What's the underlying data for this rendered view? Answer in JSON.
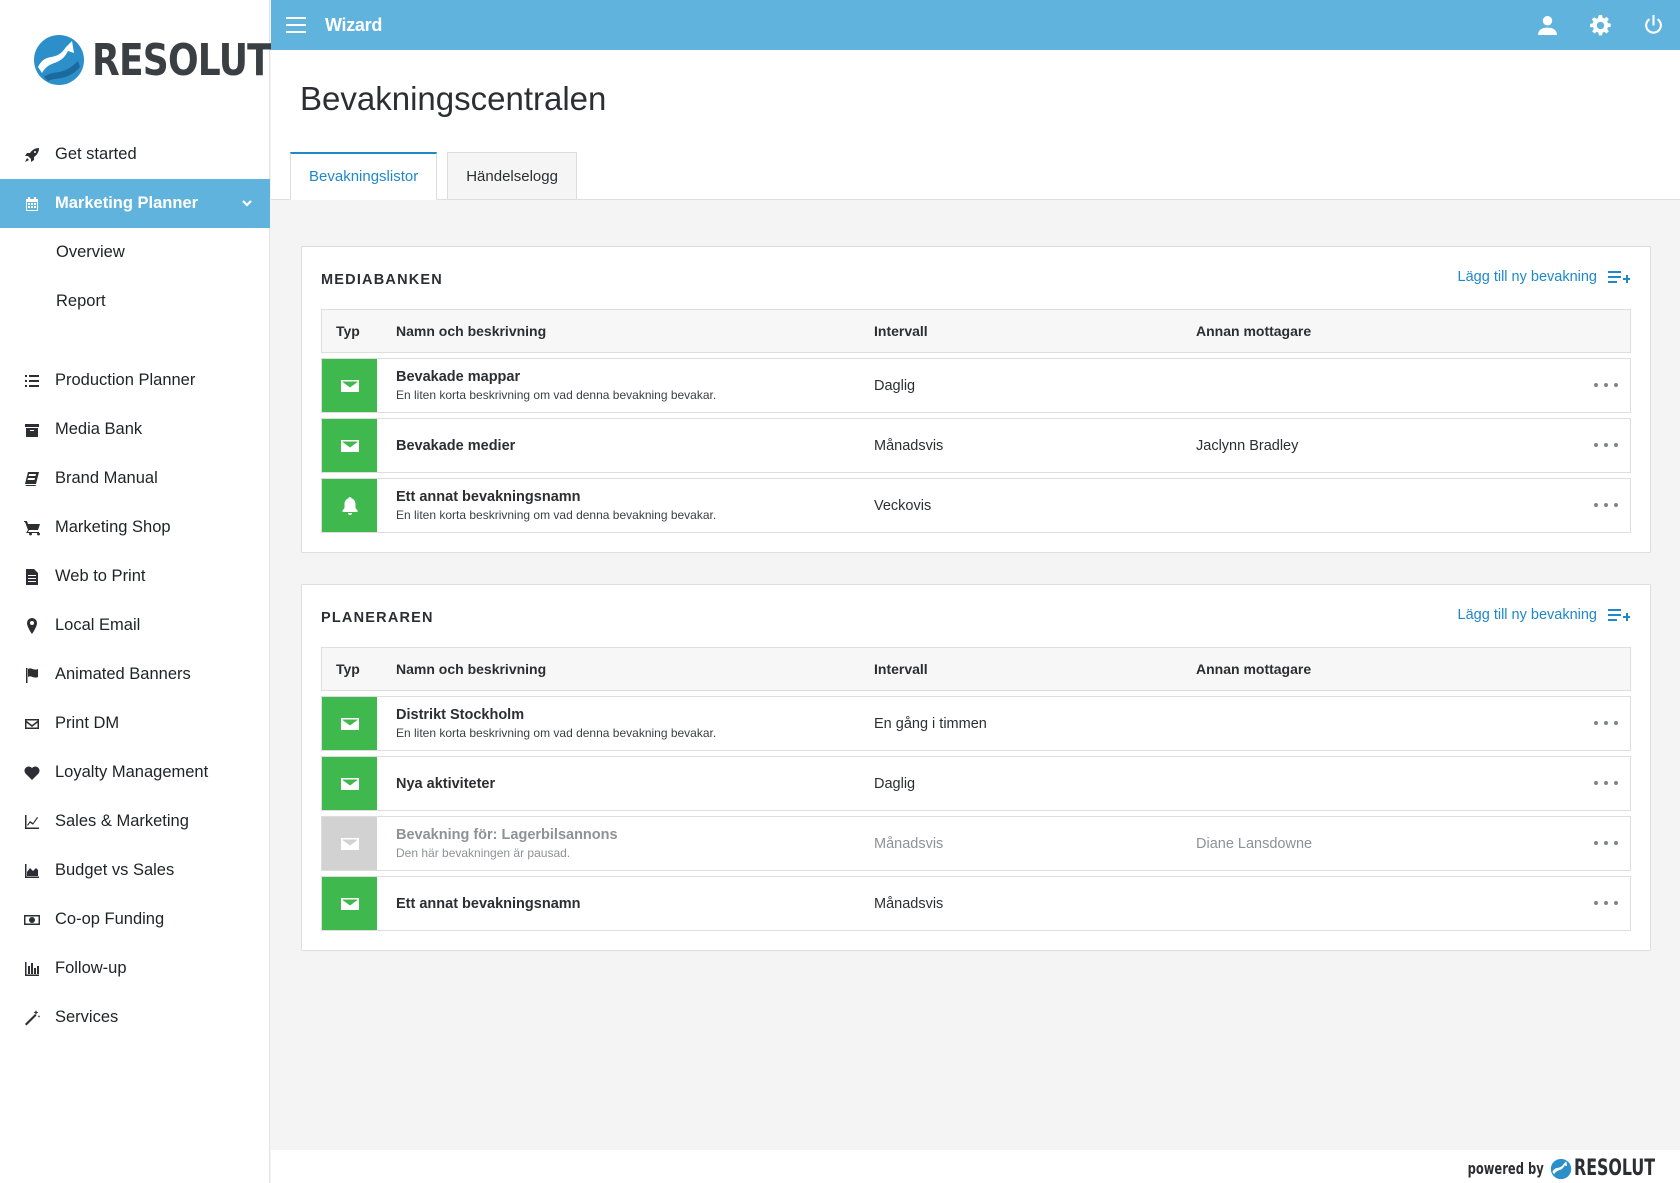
{
  "brand": {
    "logo_text": "RESOLUT"
  },
  "topbar": {
    "title": "Wizard"
  },
  "sidebar": {
    "items": [
      {
        "label": "Get started",
        "icon": "rocket-icon"
      },
      {
        "label": "Marketing Planner",
        "icon": "calendar-icon",
        "active": true,
        "children": [
          {
            "label": "Overview"
          },
          {
            "label": "Report"
          }
        ]
      },
      {
        "label": "Production Planner",
        "icon": "list-icon"
      },
      {
        "label": "Media Bank",
        "icon": "archive-icon"
      },
      {
        "label": "Brand Manual",
        "icon": "book-icon"
      },
      {
        "label": "Marketing Shop",
        "icon": "cart-icon"
      },
      {
        "label": "Web to Print",
        "icon": "document-icon"
      },
      {
        "label": "Local Email",
        "icon": "map-pin-icon"
      },
      {
        "label": "Animated Banners",
        "icon": "flag-icon"
      },
      {
        "label": "Print DM",
        "icon": "envelope-icon"
      },
      {
        "label": "Loyalty Management",
        "icon": "heart-icon"
      },
      {
        "label": "Sales & Marketing",
        "icon": "line-chart-icon"
      },
      {
        "label": "Budget vs Sales",
        "icon": "area-chart-icon"
      },
      {
        "label": "Co-op Funding",
        "icon": "money-icon"
      },
      {
        "label": "Follow-up",
        "icon": "bar-chart-icon"
      },
      {
        "label": "Services",
        "icon": "wand-icon"
      }
    ]
  },
  "page": {
    "title": "Bevakningscentralen",
    "tabs": [
      {
        "label": "Bevakningslistor",
        "active": true
      },
      {
        "label": "Händelselogg"
      }
    ]
  },
  "table_headers": {
    "type": "Typ",
    "name": "Namn och beskrivning",
    "interval": "Intervall",
    "recipient": "Annan mottagare"
  },
  "panels": [
    {
      "title": "MEDIABANKEN",
      "add_label": "Lägg till ny bevakning",
      "rows": [
        {
          "type": "email",
          "name": "Bevakade mappar",
          "desc": "En liten korta beskrivning om vad denna bevakning bevakar.",
          "interval": "Daglig",
          "recipient": ""
        },
        {
          "type": "email",
          "name": "Bevakade medier",
          "desc": "",
          "interval": "Månadsvis",
          "recipient": "Jaclynn Bradley"
        },
        {
          "type": "bell",
          "name": "Ett annat bevakningsnamn",
          "desc": "En liten korta beskrivning om vad denna bevakning bevakar.",
          "interval": "Veckovis",
          "recipient": ""
        }
      ]
    },
    {
      "title": "PLANERAREN",
      "add_label": "Lägg till ny bevakning",
      "rows": [
        {
          "type": "email",
          "name": "Distrikt Stockholm",
          "desc": "En liten korta beskrivning om vad denna bevakning bevakar.",
          "interval": "En gång i timmen",
          "recipient": ""
        },
        {
          "type": "email",
          "name": "Nya aktiviteter",
          "desc": "",
          "interval": "Daglig",
          "recipient": ""
        },
        {
          "type": "email",
          "paused": true,
          "name": "Bevakning för: Lagerbilsannons",
          "desc": "Den här bevakningen är pausad.",
          "interval": "Månadsvis",
          "recipient": "Diane Lansdowne"
        },
        {
          "type": "email",
          "name": "Ett annat bevakningsnamn",
          "desc": "",
          "interval": "Månadsvis",
          "recipient": ""
        }
      ]
    }
  ],
  "footer": {
    "powered_by": "powered by",
    "logo_text": "RESOLUT"
  },
  "colors": {
    "accent": "#60b3dd",
    "link": "#1f88c9",
    "status_active": "#3fb94d",
    "status_paused": "#d2d2d2"
  }
}
